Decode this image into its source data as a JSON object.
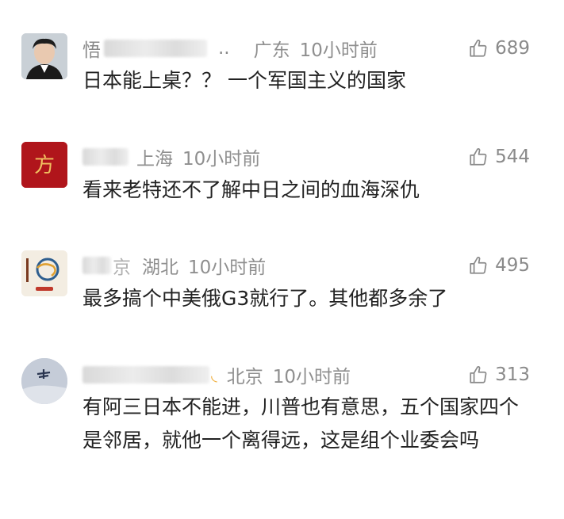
{
  "comments": [
    {
      "name_visible": "悟",
      "name_suffix": "..",
      "location": "广东",
      "time": "10小时前",
      "likes": "689",
      "text": "日本能上桌？？ 一个军国主义的国家",
      "avatar": "portrait-avatar"
    },
    {
      "name_visible": "",
      "name_suffix": "",
      "location": "上海",
      "time": "10小时前",
      "likes": "544",
      "text": "看来老特还不了解中日之间的血海深仇",
      "avatar_glyph": "方"
    },
    {
      "name_visible": "",
      "name_suffix": "京",
      "location": "湖北",
      "time": "10小时前",
      "likes": "495",
      "text": "最多搞个中美俄G3就行了。其他都多余了",
      "avatar": "dragon-avatar"
    },
    {
      "name_visible": "",
      "name_suffix": "",
      "location": "北京",
      "time": "10小时前",
      "likes": "313",
      "text": "有阿三日本不能进，川普也有意思，五个国家四个是邻居，就他一个离得远，这是组个业委会吗",
      "avatar": "bird-avatar"
    }
  ],
  "colors": {
    "meta": "#8f8f8f",
    "text": "#222222",
    "avatar2_bg": "#b0151b",
    "avatar2_glyph": "#f0c060"
  }
}
